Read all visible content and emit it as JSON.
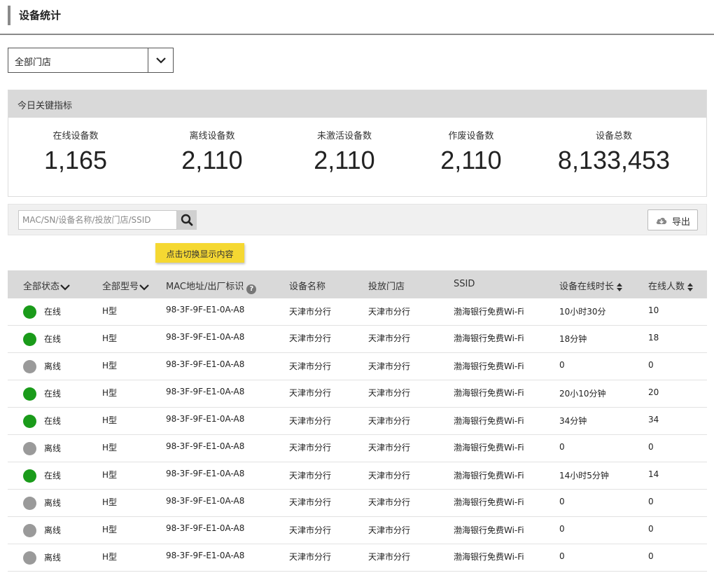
{
  "page": {
    "title": "设备统计"
  },
  "store_select": {
    "value": "全部门店"
  },
  "kpi": {
    "header": "今日关键指标",
    "items": [
      {
        "label": "在线设备数",
        "value": "1,165"
      },
      {
        "label": "离线设备数",
        "value": "2,110"
      },
      {
        "label": "未激活设备数",
        "value": "2,110"
      },
      {
        "label": "作废设备数",
        "value": "2,110"
      },
      {
        "label": "设备总数",
        "value": "8,133,453"
      }
    ]
  },
  "search": {
    "placeholder": "MAC/SN/设备名称/投放门店/SSID",
    "export_label": "导出"
  },
  "tooltip": "点击切换显示内容",
  "table": {
    "headers": {
      "status": "全部状态",
      "model": "全部型号",
      "mac": "MAC地址/出厂标识",
      "name": "设备名称",
      "store": "投放门店",
      "ssid": "SSID",
      "duration": "设备在线时长",
      "users": "在线人数"
    },
    "colors": {
      "online": "#1a9b1a",
      "offline": "#9a9a9a"
    },
    "rows": [
      {
        "online": true,
        "status": "在线",
        "model": "H型",
        "mac": "98-3F-9F-E1-0A-A8",
        "name": "天津市分行",
        "store": "天津市分行",
        "ssid": "渤海银行免费Wi-Fi",
        "duration": "10小时30分",
        "users": "10"
      },
      {
        "online": true,
        "status": "在线",
        "model": "H型",
        "mac": "98-3F-9F-E1-0A-A8",
        "name": "天津市分行",
        "store": "天津市分行",
        "ssid": "渤海银行免费Wi-Fi",
        "duration": "18分钟",
        "users": "18"
      },
      {
        "online": false,
        "status": "离线",
        "model": "H型",
        "mac": "98-3F-9F-E1-0A-A8",
        "name": "天津市分行",
        "store": "天津市分行",
        "ssid": "渤海银行免费Wi-Fi",
        "duration": "0",
        "users": "0"
      },
      {
        "online": true,
        "status": "在线",
        "model": "H型",
        "mac": "98-3F-9F-E1-0A-A8",
        "name": "天津市分行",
        "store": "天津市分行",
        "ssid": "渤海银行免费Wi-Fi",
        "duration": "20小10分钟",
        "users": "20"
      },
      {
        "online": true,
        "status": "在线",
        "model": "H型",
        "mac": "98-3F-9F-E1-0A-A8",
        "name": "天津市分行",
        "store": "天津市分行",
        "ssid": "渤海银行免费Wi-Fi",
        "duration": "34分钟",
        "users": "34"
      },
      {
        "online": false,
        "status": "离线",
        "model": "H型",
        "mac": "98-3F-9F-E1-0A-A8",
        "name": "天津市分行",
        "store": "天津市分行",
        "ssid": "渤海银行免费Wi-Fi",
        "duration": "0",
        "users": "0"
      },
      {
        "online": true,
        "status": "在线",
        "model": "H型",
        "mac": "98-3F-9F-E1-0A-A8",
        "name": "天津市分行",
        "store": "天津市分行",
        "ssid": "渤海银行免费Wi-Fi",
        "duration": "14小时5分钟",
        "users": "14"
      },
      {
        "online": false,
        "status": "离线",
        "model": "H型",
        "mac": "98-3F-9F-E1-0A-A8",
        "name": "天津市分行",
        "store": "天津市分行",
        "ssid": "渤海银行免费Wi-Fi",
        "duration": "0",
        "users": "0"
      },
      {
        "online": false,
        "status": "离线",
        "model": "H型",
        "mac": "98-3F-9F-E1-0A-A8",
        "name": "天津市分行",
        "store": "天津市分行",
        "ssid": "渤海银行免费Wi-Fi",
        "duration": "0",
        "users": "0"
      },
      {
        "online": false,
        "status": "离线",
        "model": "H型",
        "mac": "98-3F-9F-E1-0A-A8",
        "name": "天津市分行",
        "store": "天津市分行",
        "ssid": "渤海银行免费Wi-Fi",
        "duration": "0",
        "users": "0"
      }
    ]
  }
}
